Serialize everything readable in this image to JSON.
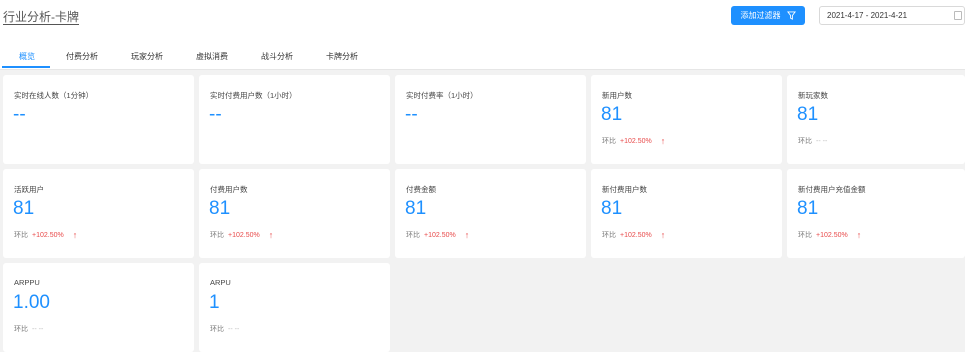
{
  "header": {
    "title": "行业分析-卡牌",
    "filter_button": "添加过滤器",
    "date_range": "2021-4-17 - 2021-4-21"
  },
  "tabs": [
    {
      "label": "概览",
      "active": true
    },
    {
      "label": "付费分析"
    },
    {
      "label": "玩家分析"
    },
    {
      "label": "虚拟消费"
    },
    {
      "label": "战斗分析"
    },
    {
      "label": "卡牌分析"
    }
  ],
  "cards": [
    {
      "label": "实时在线人数（1分钟）",
      "value": "--"
    },
    {
      "label": "实时付费用户数（1小时）",
      "value": "--"
    },
    {
      "label": "实时付费率（1小时）",
      "value": "--"
    },
    {
      "label": "新用户数",
      "value": "81",
      "ratio_label": "环比",
      "ratio": "+102.50%"
    },
    {
      "label": "新玩家数",
      "value": "81",
      "ratio_label": "环比",
      "ratio": "-- --"
    },
    {
      "label": "活跃用户",
      "value": "81",
      "ratio_label": "环比",
      "ratio": "+102.50%"
    },
    {
      "label": "付费用户数",
      "value": "81",
      "ratio_label": "环比",
      "ratio": "+102.50%"
    },
    {
      "label": "付费金额",
      "value": "81",
      "ratio_label": "环比",
      "ratio": "+102.50%"
    },
    {
      "label": "新付费用户数",
      "value": "81",
      "ratio_label": "环比",
      "ratio": "+102.50%"
    },
    {
      "label": "新付费用户充值金额",
      "value": "81",
      "ratio_label": "环比",
      "ratio": "+102.50%"
    },
    {
      "label": "ARPPU",
      "value": "1.00",
      "ratio_label": "环比",
      "ratio": "-- --"
    },
    {
      "label": "ARPU",
      "value": "1",
      "ratio_label": "环比",
      "ratio": "-- --"
    }
  ],
  "colors": {
    "accent": "#1e90ff",
    "up": "#e84a4a",
    "page_bg": "#f2f2f2"
  },
  "icons": {
    "filter": "filter-icon",
    "calendar": "calendar-icon",
    "trend": "arrow-up-icon"
  }
}
